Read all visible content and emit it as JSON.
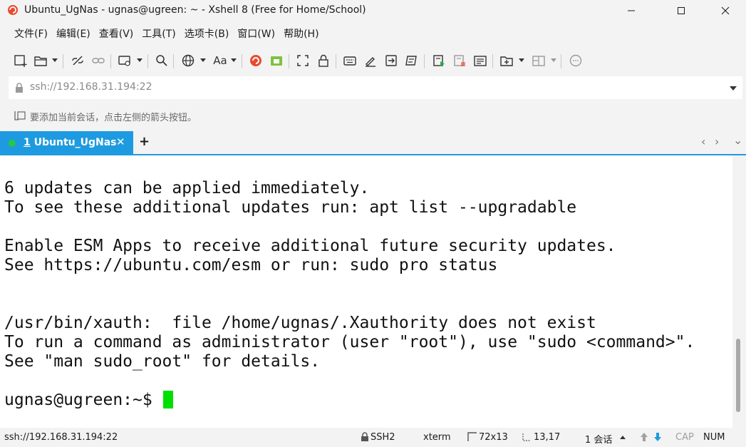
{
  "window": {
    "title": "Ubuntu_UgNas - ugnas@ugreen: ~ - Xshell 8 (Free for Home/School)"
  },
  "menu": [
    {
      "label": "文件(F)"
    },
    {
      "label": "编辑(E)"
    },
    {
      "label": "查看(V)"
    },
    {
      "label": "工具(T)"
    },
    {
      "label": "选项卡(B)"
    },
    {
      "label": "窗口(W)"
    },
    {
      "label": "帮助(H)"
    }
  ],
  "toolbar": {
    "font_button_label": "Aa",
    "icons": [
      "new-session-icon",
      "open-folder-icon",
      "disconnect-icon",
      "reconnect-icon",
      "new-window-icon",
      "search-icon",
      "globe-icon",
      "font-icon",
      "xshell-icon",
      "xftp-icon",
      "fullscreen-icon",
      "lock-icon",
      "keyboard-icon",
      "highlight-icon",
      "send-icon",
      "script-icon",
      "start-log-icon",
      "print-icon",
      "compose-icon",
      "new-tab-icon",
      "layout-icon",
      "chat-icon"
    ]
  },
  "address": {
    "value": "ssh://192.168.31.194:22"
  },
  "hint": {
    "text": "要添加当前会话，点击左侧的箭头按钮。"
  },
  "tabs": [
    {
      "number": "1",
      "name": "Ubuntu_UgNas",
      "status_color": "#22c84a"
    }
  ],
  "terminal": {
    "lines": [
      "6 updates can be applied immediately.",
      "To see these additional updates run: apt list --upgradable",
      "",
      "Enable ESM Apps to receive additional future security updates.",
      "See https://ubuntu.com/esm or run: sudo pro status",
      "",
      "",
      "/usr/bin/xauth:  file /home/ugnas/.Xauthority does not exist",
      "To run a command as administrator (user \"root\"), use \"sudo <command>\".",
      "See \"man sudo_root\" for details.",
      "",
      "ugnas@ugreen:~$ "
    ],
    "cursor_color": "#00e000"
  },
  "status": {
    "address": "ssh://192.168.31.194:22",
    "protocol": "SSH2",
    "term": "xterm",
    "size": "72x13",
    "position": "13,17",
    "sessions": "1 会话",
    "cap": "CAP",
    "num": "NUM"
  },
  "colors": {
    "accent": "#1e9be0",
    "chrome": "#f3f3f3"
  }
}
